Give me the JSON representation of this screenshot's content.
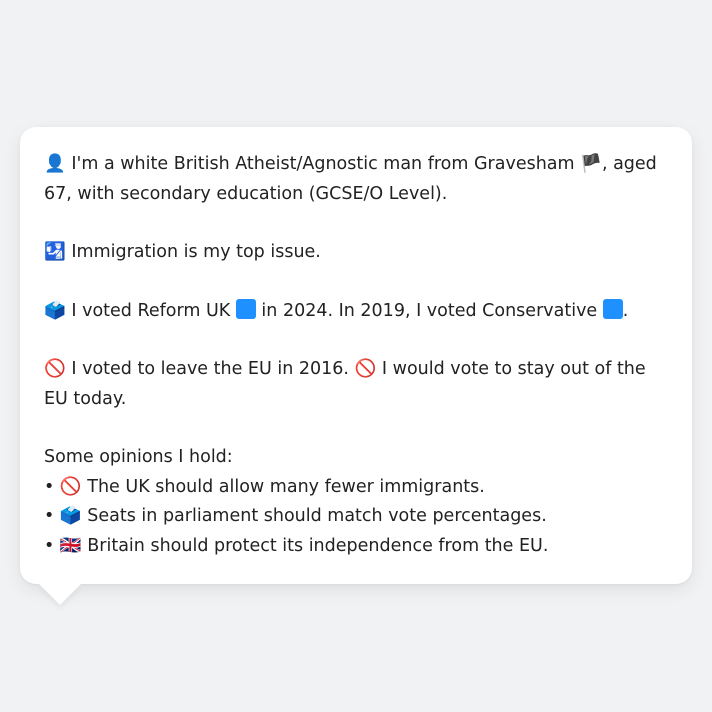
{
  "profile": {
    "intro": {
      "icon": "👤",
      "text_before_flag": "I'm a white British Atheist/Agnostic man from Gravesham",
      "flag": "🏴",
      "text_after_flag": ", aged 67, with secondary education (GCSE/O Level)."
    },
    "top_issue": {
      "icon": "🛂",
      "text": "Immigration is my top issue."
    },
    "voting": {
      "icon": "🗳️",
      "part1": "I voted Reform UK",
      "part2": "in 2024. In 2019, I voted Conservative",
      "part3": ".",
      "reform_color": "#1e90ff",
      "conservative_color": "#1e90ff"
    },
    "eu": {
      "icon1": "🚫",
      "text1": "I voted to leave the EU in 2016.",
      "icon2": "🚫",
      "text2": "I would vote to stay out of the EU today."
    },
    "opinions": {
      "heading": "Some opinions I hold:",
      "items": [
        {
          "bullet": "•",
          "icon": "🚫",
          "text": "The UK should allow many fewer immigrants."
        },
        {
          "bullet": "•",
          "icon": "🗳️",
          "text": "Seats in parliament should match vote percentages."
        },
        {
          "bullet": "•",
          "icon": "🇬🇧",
          "text": "Britain should protect its independence from the EU."
        }
      ]
    }
  }
}
